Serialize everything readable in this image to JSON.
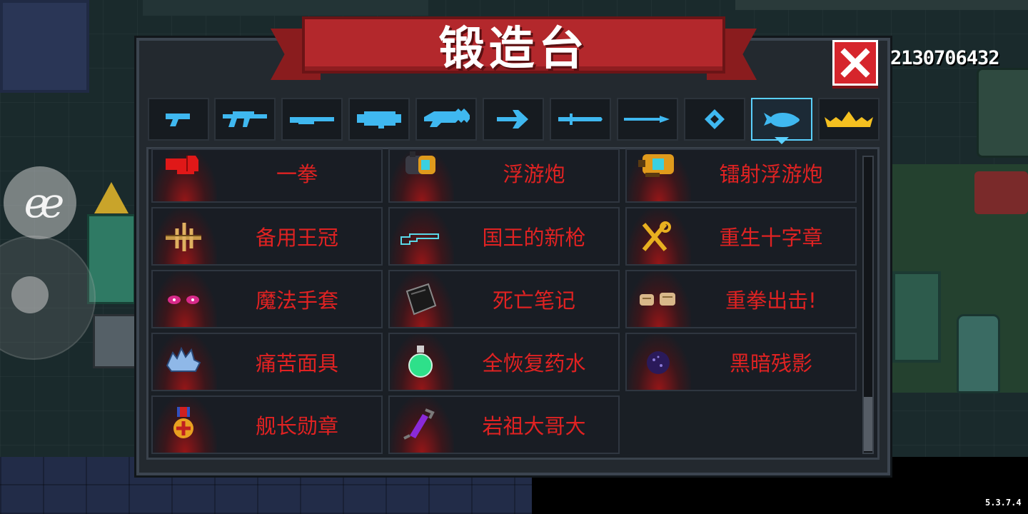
{
  "title": "锻造台",
  "gem_count": "2130706432",
  "version": "5.3.7.4",
  "colors": {
    "ribbon": "#b3282c",
    "item_text": "#e02222",
    "tab_icon": "#3fb8f0",
    "selected_tab": "#5ad0ff"
  },
  "tabs": [
    {
      "icon": "pistol-icon"
    },
    {
      "icon": "assault-rifle-icon"
    },
    {
      "icon": "shotgun-icon"
    },
    {
      "icon": "rocket-launcher-icon"
    },
    {
      "icon": "laser-gun-icon"
    },
    {
      "icon": "bow-icon"
    },
    {
      "icon": "sword-icon"
    },
    {
      "icon": "spear-icon"
    },
    {
      "icon": "staff-icon"
    },
    {
      "icon": "fish-icon",
      "selected": true
    },
    {
      "icon": "crown-icon"
    }
  ],
  "items": [
    {
      "name": "一拳",
      "icon": "red-fist-icon"
    },
    {
      "name": "浮游炮",
      "icon": "floating-cannon-icon"
    },
    {
      "name": "镭射浮游炮",
      "icon": "laser-floating-cannon-icon"
    },
    {
      "name": "备用王冠",
      "icon": "spare-crown-icon"
    },
    {
      "name": "国王的新枪",
      "icon": "kings-new-gun-icon"
    },
    {
      "name": "重生十字章",
      "icon": "rebirth-cross-icon"
    },
    {
      "name": "魔法手套",
      "icon": "magic-gloves-icon"
    },
    {
      "name": "死亡笔记",
      "icon": "death-note-icon"
    },
    {
      "name": "重拳出击!",
      "icon": "heavy-punch-icon"
    },
    {
      "name": "痛苦面具",
      "icon": "pain-mask-icon"
    },
    {
      "name": "全恢复药水",
      "icon": "full-recovery-potion-icon"
    },
    {
      "name": "黑暗残影",
      "icon": "dark-shadow-icon"
    },
    {
      "name": "舰长勋章",
      "icon": "captain-medal-icon"
    },
    {
      "name": "岩祖大哥大",
      "icon": "rock-ancestor-phone-icon"
    }
  ]
}
